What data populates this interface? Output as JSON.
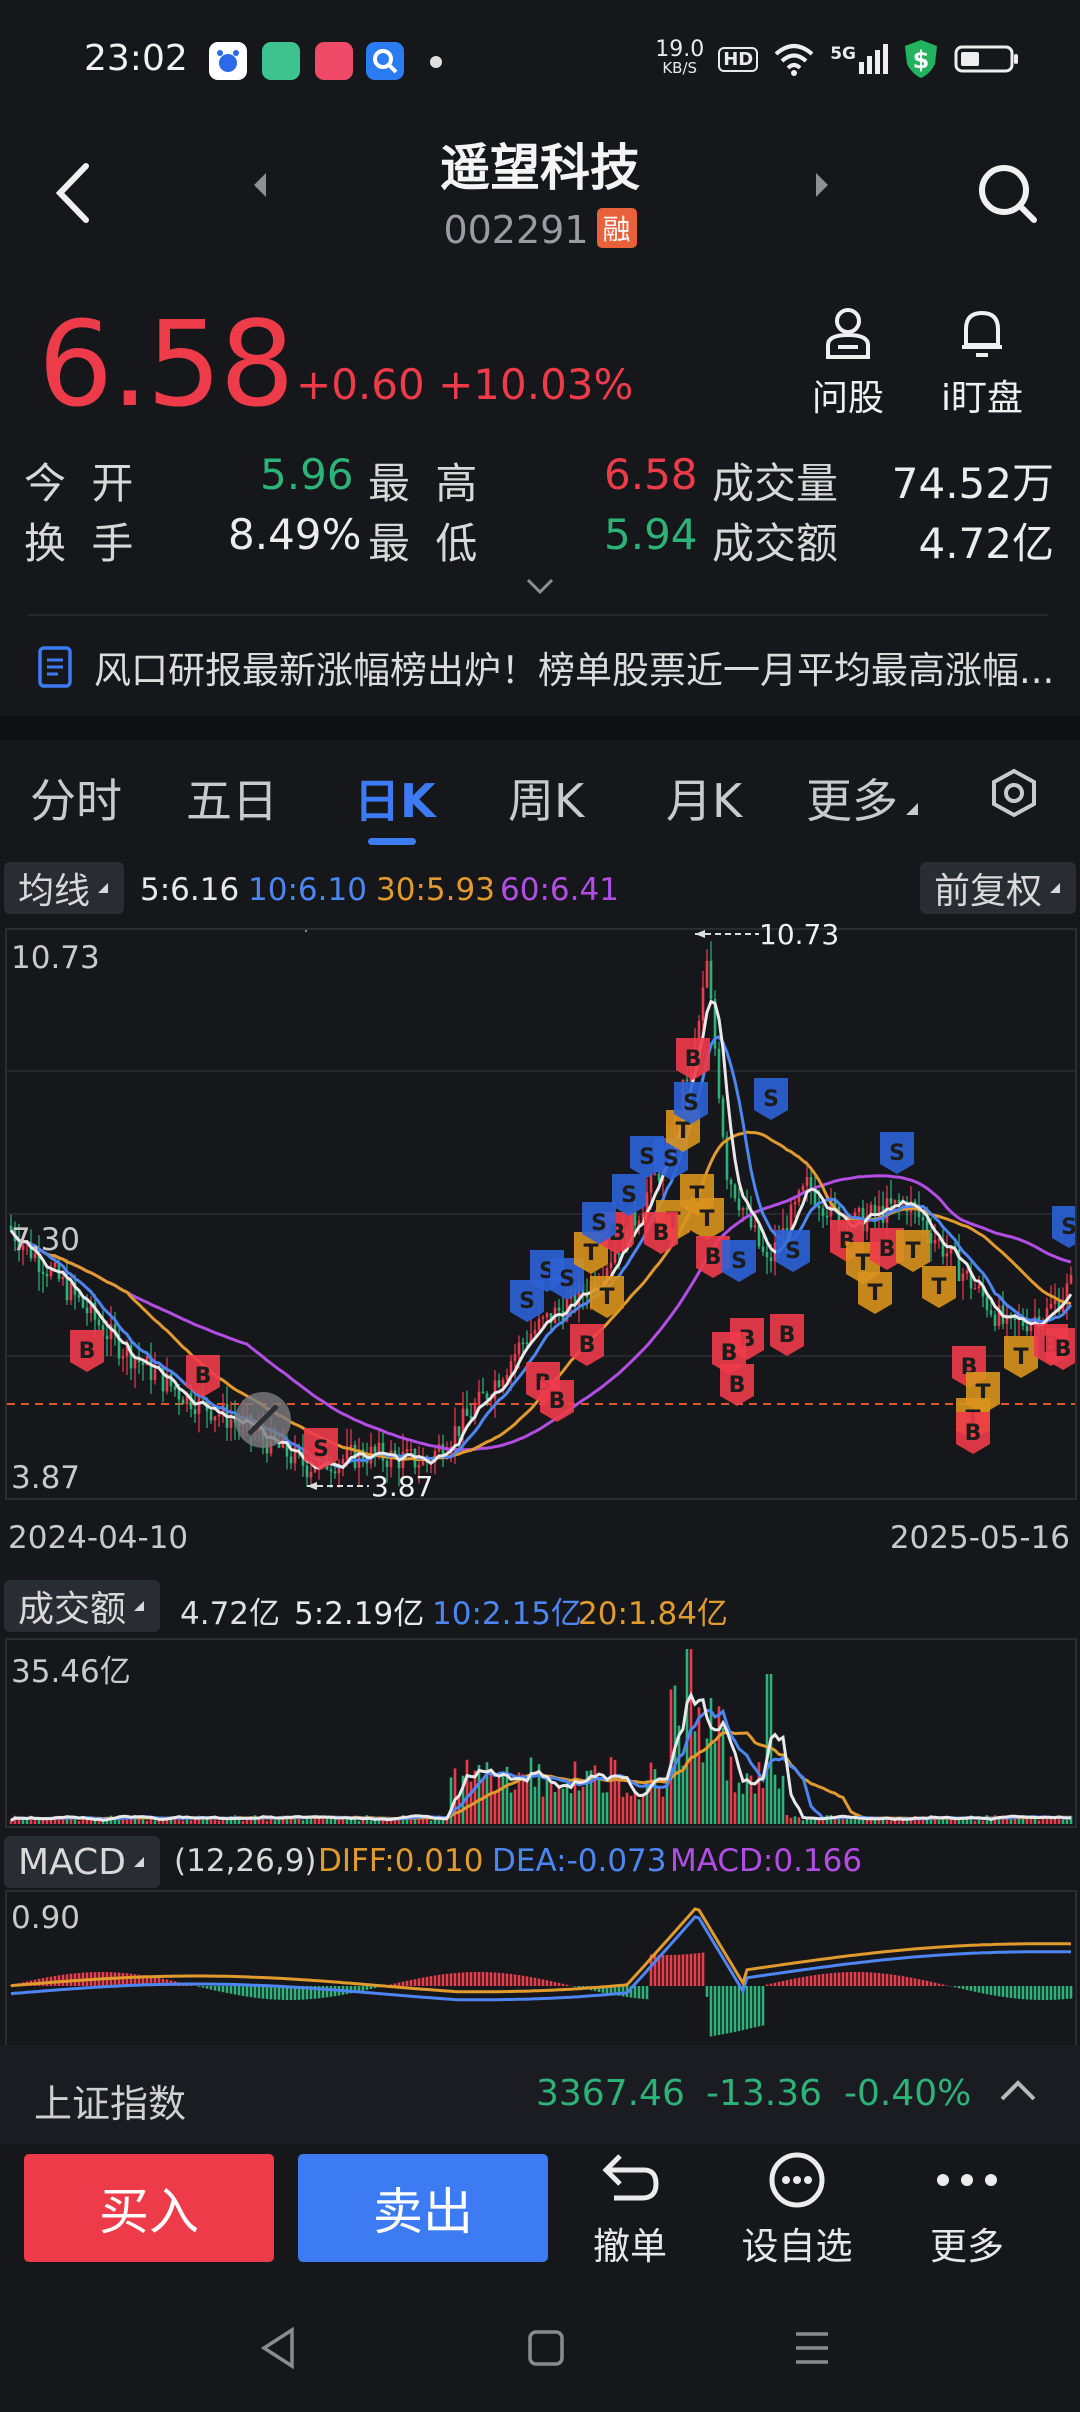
{
  "status_bar": {
    "time": "23:02",
    "net_speed_value": "19.0",
    "net_speed_unit": "KB/S",
    "hd": "HD",
    "signal": "5G"
  },
  "header": {
    "title": "遥望科技",
    "code": "002291",
    "badge": "融"
  },
  "quote": {
    "price": "6.58",
    "change": "+0.60",
    "change_pct": "+10.03%",
    "ask_label": "问股",
    "watch_label": "i盯盘",
    "open_label": "今 开",
    "open_value": "5.96",
    "high_label": "最 高",
    "high_value": "6.58",
    "volume_label": "成交量",
    "volume_value": "74.52万",
    "turnover_label": "换 手",
    "turnover_value": "8.49%",
    "low_label": "最 低",
    "low_value": "5.94",
    "amount_label": "成交额",
    "amount_value": "4.72亿"
  },
  "news": {
    "text": "风口研报最新涨幅榜出炉！榜单股票近一月平均最高涨幅..."
  },
  "tabs": [
    {
      "label": "分时"
    },
    {
      "label": "五日"
    },
    {
      "label": "日K"
    },
    {
      "label": "周K"
    },
    {
      "label": "月K"
    },
    {
      "label": "更多"
    }
  ],
  "kline": {
    "ma_button": "均线",
    "fq_button": "前复权",
    "ma5": "5:6.16",
    "ma10": "10:6.10",
    "ma30": "30:5.93",
    "ma60": "60:6.41",
    "y_top": "10.73",
    "y_mid": "7.30",
    "y_bottom": "3.87",
    "high_marker": "10.73",
    "low_marker": "3.87",
    "date_start": "2024-04-10",
    "date_end": "2025-05-16"
  },
  "volume": {
    "button": "成交额",
    "current": "4.72亿",
    "ma5": "5:2.19亿",
    "ma10": "10:2.15亿",
    "ma20": "20:1.84亿",
    "y_top": "35.46亿"
  },
  "macd": {
    "button": "MACD",
    "params": "(12,26,9)",
    "diff": "DIFF:0.010",
    "dea": "DEA:-0.073",
    "macd": "MACD:0.166",
    "y_top": "0.90"
  },
  "index": {
    "name": "上证指数",
    "value": "3367.46",
    "change": "-13.36",
    "pct": "-0.40%"
  },
  "bottom": {
    "buy": "买入",
    "sell": "卖出",
    "cancel": "撤单",
    "watchlist": "设自选",
    "more": "更多"
  },
  "colors": {
    "up": "#ee3b4a",
    "down": "#2db277",
    "accent": "#3d7bf2",
    "bg": "#16171b"
  }
}
